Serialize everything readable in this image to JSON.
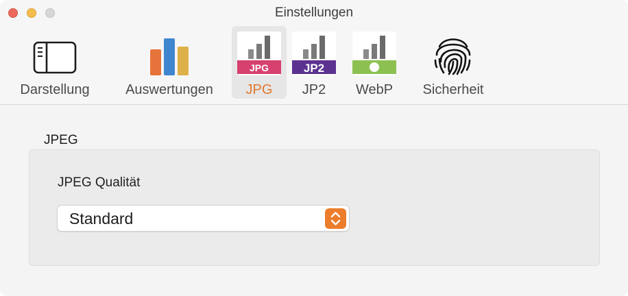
{
  "window": {
    "title": "Einstellungen"
  },
  "toolbar": {
    "tabs": [
      {
        "label": "Darstellung",
        "icon": "sidebar-layout-icon",
        "selected": false
      },
      {
        "label": "Auswertungen",
        "icon": "bar-chart-icon",
        "selected": false
      },
      {
        "label": "JPG",
        "icon": "jpg-format-icon",
        "badge": "JPG",
        "selected": true
      },
      {
        "label": "JP2",
        "icon": "jp2-format-icon",
        "badge": "JP2",
        "selected": false
      },
      {
        "label": "WebP",
        "icon": "webp-format-icon",
        "selected": false
      },
      {
        "label": "Sicherheit",
        "icon": "fingerprint-icon",
        "selected": false
      }
    ]
  },
  "content": {
    "section_title": "JPEG",
    "quality_label": "JPEG Qualität",
    "quality_select": {
      "value": "Standard"
    }
  },
  "colors": {
    "accent": "#e0772d",
    "jpg_badge": "#d6416f",
    "jp2_badge": "#5b3290",
    "webp_badge": "#8cc152"
  }
}
